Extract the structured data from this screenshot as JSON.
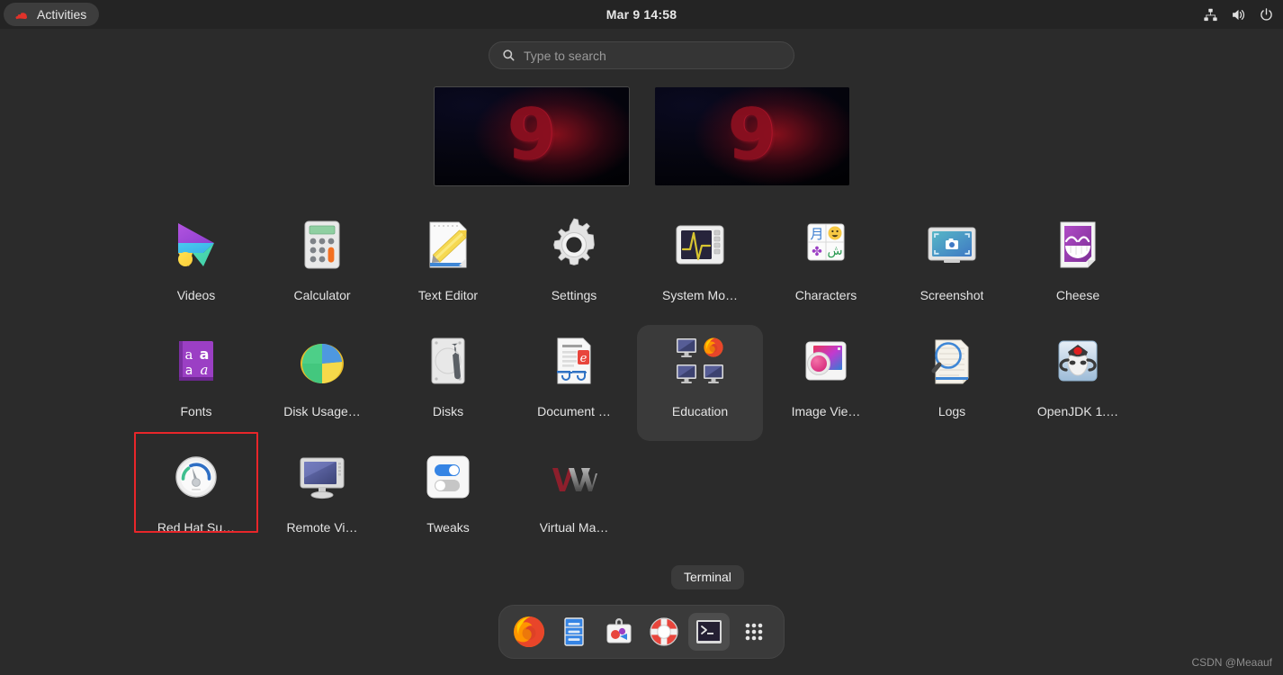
{
  "topbar": {
    "activities_label": "Activities",
    "activities_icon": "redhat-hat-icon",
    "clock": "Mar 9  14:58",
    "status_icons": [
      "network-icon",
      "volume-icon",
      "power-icon"
    ]
  },
  "search": {
    "placeholder": "Type to search",
    "value": "",
    "icon": "search-icon"
  },
  "workspaces": [
    {
      "name": "workspace-1",
      "label": "9",
      "active": true
    },
    {
      "name": "workspace-2",
      "label": "9",
      "active": false
    }
  ],
  "apps": {
    "rows": [
      [
        {
          "label": "Videos",
          "icon": "videos-icon",
          "selected": false,
          "annotated": false
        },
        {
          "label": "Calculator",
          "icon": "calculator-icon",
          "selected": false,
          "annotated": false
        },
        {
          "label": "Text Editor",
          "icon": "text-editor-icon",
          "selected": false,
          "annotated": false
        },
        {
          "label": "Settings",
          "icon": "settings-gear-icon",
          "selected": false,
          "annotated": false
        },
        {
          "label": "System Mo…",
          "icon": "system-monitor-icon",
          "selected": false,
          "annotated": false
        },
        {
          "label": "Characters",
          "icon": "characters-icon",
          "selected": false,
          "annotated": false
        },
        {
          "label": "Screenshot",
          "icon": "screenshot-icon",
          "selected": false,
          "annotated": false
        },
        {
          "label": "Cheese",
          "icon": "cheese-icon",
          "selected": false,
          "annotated": false
        }
      ],
      [
        {
          "label": "Fonts",
          "icon": "fonts-icon",
          "selected": false,
          "annotated": false
        },
        {
          "label": "Disk Usage…",
          "icon": "disk-usage-icon",
          "selected": false,
          "annotated": false
        },
        {
          "label": "Disks",
          "icon": "disks-icon",
          "selected": false,
          "annotated": false
        },
        {
          "label": "Document …",
          "icon": "document-viewer-icon",
          "selected": false,
          "annotated": false
        },
        {
          "label": "Education",
          "icon": "education-folder-icon",
          "selected": true,
          "annotated": false
        },
        {
          "label": "Image Vie…",
          "icon": "image-viewer-icon",
          "selected": false,
          "annotated": false
        },
        {
          "label": "Logs",
          "icon": "logs-icon",
          "selected": false,
          "annotated": false
        },
        {
          "label": "OpenJDK 1.…",
          "icon": "openjdk-icon",
          "selected": false,
          "annotated": false
        }
      ],
      [
        {
          "label": "Red Hat Su…",
          "icon": "redhat-subscription-icon",
          "selected": false,
          "annotated": true
        },
        {
          "label": "Remote Vi…",
          "icon": "remote-viewer-icon",
          "selected": false,
          "annotated": false
        },
        {
          "label": "Tweaks",
          "icon": "tweaks-icon",
          "selected": false,
          "annotated": false
        },
        {
          "label": "Virtual Ma…",
          "icon": "virtual-machine-manager-icon",
          "selected": false,
          "annotated": false
        }
      ]
    ]
  },
  "tooltip": {
    "text": "Terminal"
  },
  "dock": {
    "items": [
      {
        "name": "firefox",
        "icon": "firefox-icon",
        "active": false
      },
      {
        "name": "files",
        "icon": "files-icon",
        "active": false
      },
      {
        "name": "software",
        "icon": "software-icon",
        "active": false
      },
      {
        "name": "help",
        "icon": "help-lifebuoy-icon",
        "active": false
      },
      {
        "name": "terminal",
        "icon": "terminal-icon",
        "active": true
      },
      {
        "name": "show-apps",
        "icon": "app-grid-icon",
        "active": false
      }
    ]
  },
  "watermark": {
    "text": "CSDN @Meaauf"
  },
  "colors": {
    "background": "#2b2b2b",
    "topbar": "#242424",
    "accent_red": "#e8262a",
    "selection": "#3a3a3a",
    "text": "#e3e3e3",
    "muted_text": "#9a9a9a"
  }
}
